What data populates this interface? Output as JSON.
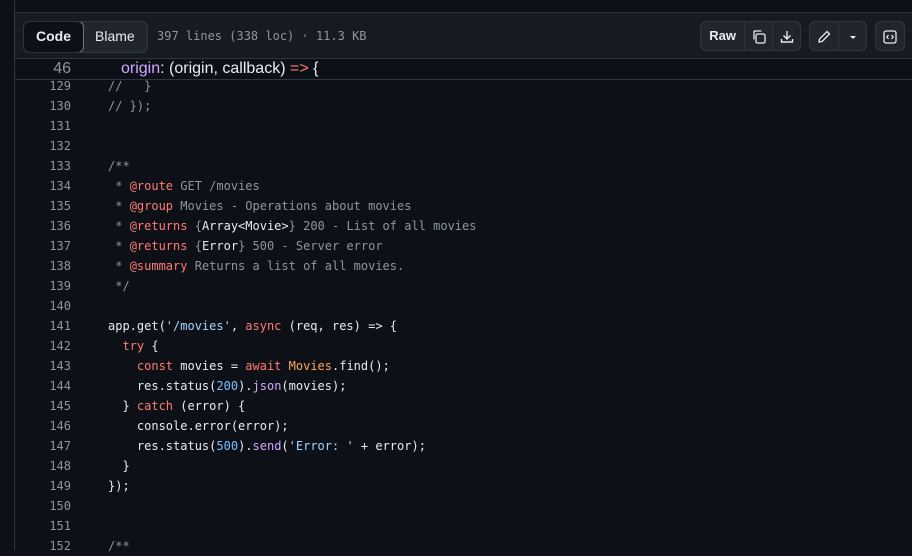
{
  "toolbar": {
    "code_label": "Code",
    "blame_label": "Blame",
    "file_meta": "397 lines (338 loc) · 11.3 KB",
    "raw_label": "Raw",
    "icons": [
      "copy-icon",
      "download-icon",
      "pencil-icon",
      "chevron-down-icon",
      "symbols-icon"
    ]
  },
  "sticky": {
    "line": "46",
    "text": "origin: (origin, callback) => {"
  },
  "lines": [
    {
      "n": "129",
      "t": "//   }"
    },
    {
      "n": "130",
      "t": "// });"
    },
    {
      "n": "131",
      "t": ""
    },
    {
      "n": "132",
      "t": ""
    },
    {
      "n": "133",
      "t": "/**"
    },
    {
      "n": "134",
      "t": " * @route GET /movies"
    },
    {
      "n": "135",
      "t": " * @group Movies - Operations about movies"
    },
    {
      "n": "136",
      "t": " * @returns {Array<Movie>} 200 - List of all movies"
    },
    {
      "n": "137",
      "t": " * @returns {Error} 500 - Server error"
    },
    {
      "n": "138",
      "t": " * @summary Returns a list of all movies."
    },
    {
      "n": "139",
      "t": " */"
    },
    {
      "n": "140",
      "t": ""
    },
    {
      "n": "141",
      "t": "app.get('/movies', async (req, res) => {"
    },
    {
      "n": "142",
      "t": "  try {"
    },
    {
      "n": "143",
      "t": "    const movies = await Movies.find();"
    },
    {
      "n": "144",
      "t": "    res.status(200).json(movies);"
    },
    {
      "n": "145",
      "t": "  } catch (error) {"
    },
    {
      "n": "146",
      "t": "    console.error(error);"
    },
    {
      "n": "147",
      "t": "    res.status(500).send('Error: ' + error);"
    },
    {
      "n": "148",
      "t": "  }"
    },
    {
      "n": "149",
      "t": "});"
    },
    {
      "n": "150",
      "t": ""
    },
    {
      "n": "151",
      "t": ""
    },
    {
      "n": "152",
      "t": "/**"
    }
  ]
}
